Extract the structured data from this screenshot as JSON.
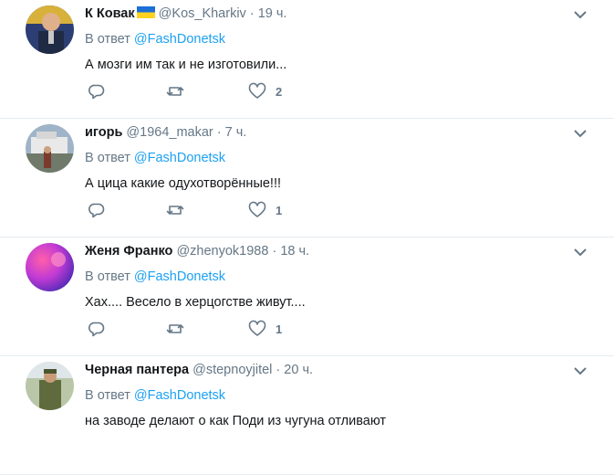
{
  "tweets": [
    {
      "name": "К Ковак",
      "handle": "@Kos_Kharkiv",
      "time": "19 ч.",
      "reply_prefix": "В ответ",
      "reply_to": "@FashDonetsk",
      "text": "А мозги им так и не изготовили...",
      "likes": "2"
    },
    {
      "name": "игорь",
      "handle": "@1964_makar",
      "time": "7 ч.",
      "reply_prefix": "В ответ",
      "reply_to": "@FashDonetsk",
      "text": "А цица какие одухотворённые!!!",
      "likes": "1"
    },
    {
      "name": "Женя Франко",
      "handle": "@zhenyok1988",
      "time": "18 ч.",
      "reply_prefix": "В ответ",
      "reply_to": "@FashDonetsk",
      "text": "Хах.... Весело в херцогстве живут....",
      "likes": "1"
    },
    {
      "name": "Черная пантера",
      "handle": "@stepnoyjitel",
      "time": "20 ч.",
      "reply_prefix": "В ответ",
      "reply_to": "@FashDonetsk",
      "text": "на заводе делают о как Поди из чугуна отливают",
      "likes": ""
    }
  ],
  "separator": "·",
  "colors": {
    "link": "#1da1f2",
    "muted": "#657786",
    "border": "#e6ecf0"
  },
  "icons": [
    "reply-icon",
    "retweet-icon",
    "like-icon",
    "caret-down-icon",
    "ukraine-flag-icon"
  ]
}
